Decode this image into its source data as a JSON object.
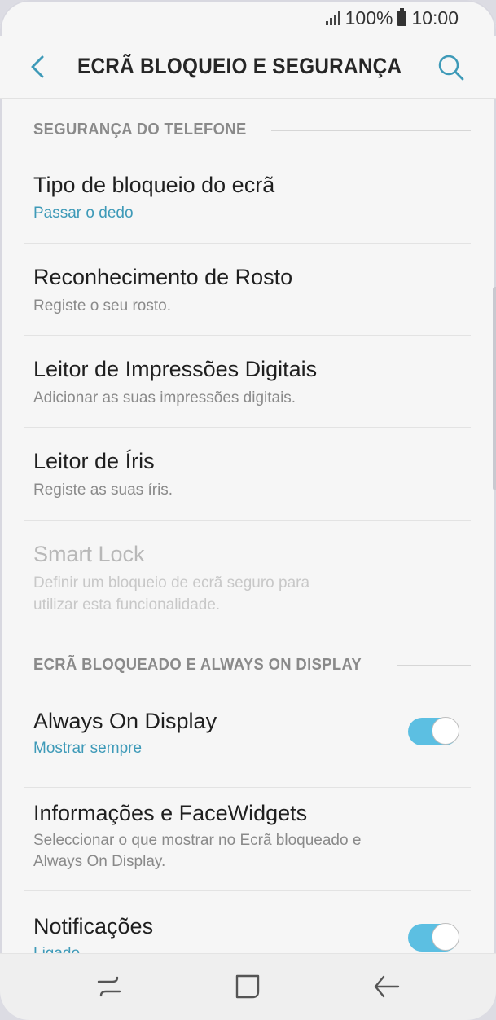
{
  "status_bar": {
    "battery": "100%",
    "time": "10:00"
  },
  "header": {
    "title": "ECRÃ BLOQUEIO E SEGURANÇA",
    "back_icon": "back-arrow-icon",
    "search_icon": "search-icon"
  },
  "sections": [
    {
      "title": "SEGURANÇA DO TELEFONE",
      "items": [
        {
          "title": "Tipo de bloqueio do ecrã",
          "subtitle": "Passar o dedo"
        },
        {
          "title": "Reconhecimento de Rosto",
          "subtitle": "Registe o seu rosto."
        },
        {
          "title": "Leitor de Impressões Digitais",
          "subtitle": "Adicionar as suas impressões digitais."
        },
        {
          "title": "Leitor de Íris",
          "subtitle": "Registe as suas íris."
        },
        {
          "title": "Smart Lock",
          "subtitle_line1": "Definir um bloqueio de ecrã seguro para",
          "subtitle_line2": "utilizar esta funcionalidade.",
          "disabled": true
        }
      ]
    },
    {
      "title": "ECRÃ BLOQUEADO E ALWAYS ON DISPLAY",
      "items": [
        {
          "title": "Always On Display",
          "subtitle": "Mostrar sempre",
          "toggle": true
        },
        {
          "title": "Informações e FaceWidgets",
          "subtitle_line1": "Seleccionar o que mostrar no Ecrã bloqueado e",
          "subtitle_line2": "Always On Display."
        },
        {
          "title": "Notificações",
          "subtitle": "Ligado",
          "toggle": true
        }
      ]
    }
  ],
  "navbar": {
    "recents_icon": "recent-apps-icon",
    "home_icon": "home-icon",
    "back_icon": "back-icon"
  },
  "colors": {
    "accent": "#3e9ab8",
    "toggle_on": "#5cbfe2",
    "background": "#f6f6f6"
  }
}
